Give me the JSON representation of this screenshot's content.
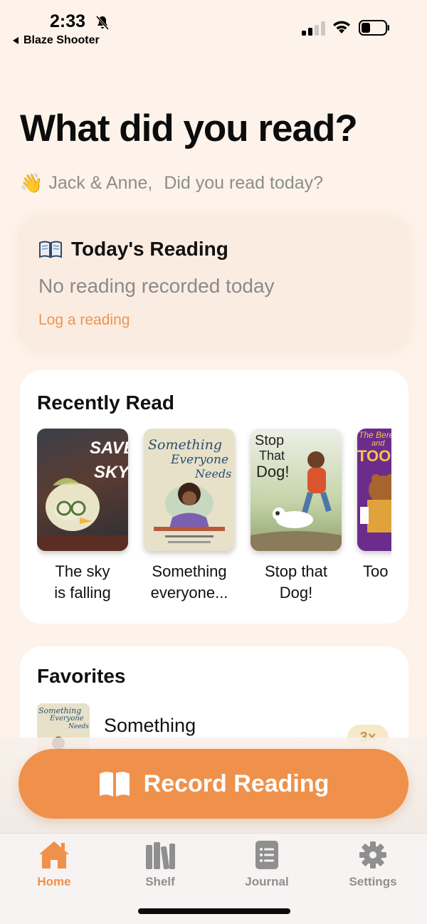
{
  "status_bar": {
    "time": "2:33",
    "back_app": "Blaze Shooter"
  },
  "header": {
    "title": "What did you read?",
    "greeting_emoji": "👋",
    "greeting_name": "Jack & Anne,",
    "greeting_question": "Did you read today?"
  },
  "today": {
    "icon": "📖",
    "title": "Today's Reading",
    "empty_text": "No reading recorded today",
    "log_link": "Log a reading"
  },
  "recently_read": {
    "title": "Recently Read",
    "books": [
      {
        "title_line1": "The sky",
        "title_line2": "is falling",
        "cover_text1": "SAVE",
        "cover_text2": "SKY"
      },
      {
        "title_line1": "Something",
        "title_line2": "everyone...",
        "cover_text1": "Something",
        "cover_text2": "Everyone",
        "cover_text3": "Needs"
      },
      {
        "title_line1": "Stop that",
        "title_line2": "Dog!",
        "cover_text1": "Stop",
        "cover_text2": "That",
        "cover_text3": "Dog!"
      },
      {
        "title_line1": "Too",
        "title_line2": "",
        "cover_text1": "The Bere",
        "cover_text2": "and",
        "cover_text3": "TOO M"
      }
    ]
  },
  "favorites": {
    "title": "Favorites",
    "items": [
      {
        "name": "Something",
        "count": "3×",
        "thumb_text1": "Something",
        "thumb_text2": "Everyone",
        "thumb_text3": "Needs"
      }
    ]
  },
  "record_button": {
    "label": "Record Reading"
  },
  "tabs": [
    {
      "label": "Home",
      "icon": "house-icon",
      "active": true
    },
    {
      "label": "Shelf",
      "icon": "books-icon",
      "active": false
    },
    {
      "label": "Journal",
      "icon": "journal-icon",
      "active": false
    },
    {
      "label": "Settings",
      "icon": "gear-icon",
      "active": false
    }
  ],
  "colors": {
    "accent": "#ef914a",
    "background": "#fdf3ea",
    "muted_text": "#8d8d8d"
  }
}
